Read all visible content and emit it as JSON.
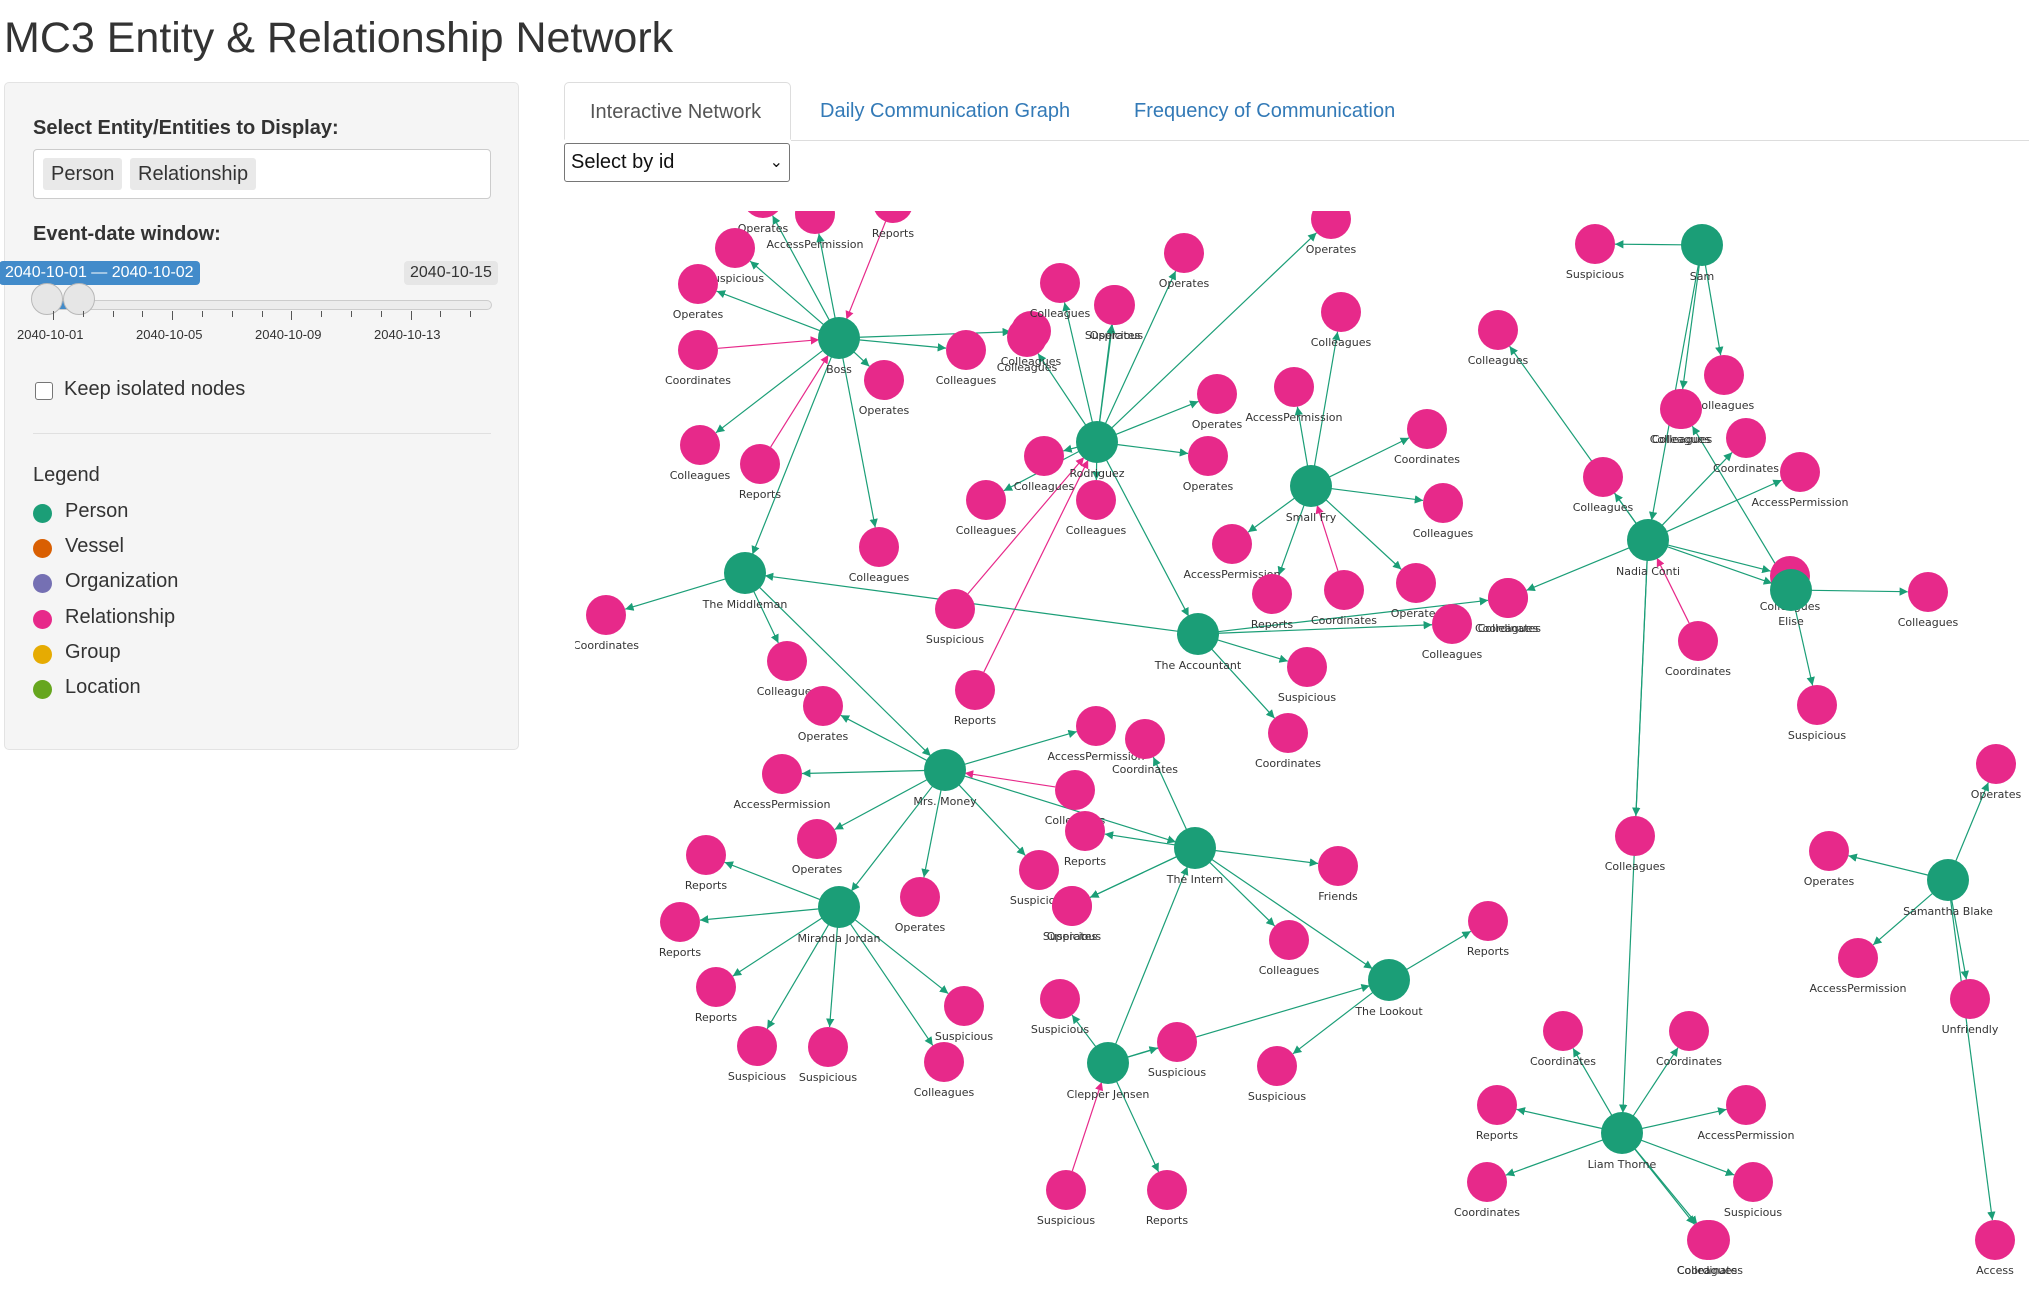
{
  "page": {
    "title": "MC3 Entity & Relationship Network"
  },
  "sidebar": {
    "entity_label": "Select Entity/Entities to Display:",
    "entity_chips": [
      "Person",
      "Relationship"
    ],
    "date_label": "Event-date window:",
    "slider": {
      "from_to_label": "2040-10-01 — 2040-10-02",
      "max_label": "2040-10-15",
      "grid_labels": [
        "2040-10-01",
        "2040-10-05",
        "2040-10-09",
        "2040-10-13"
      ],
      "selected_start": "2040-10-01",
      "selected_end": "2040-10-02"
    },
    "keep_isolated_label": "Keep isolated nodes",
    "keep_isolated_checked": false,
    "legend_title": "Legend",
    "legend": [
      {
        "label": "Person",
        "color": "#1b9e77"
      },
      {
        "label": "Vessel",
        "color": "#d95f02"
      },
      {
        "label": "Organization",
        "color": "#7570b3"
      },
      {
        "label": "Relationship",
        "color": "#e7298a"
      },
      {
        "label": "Group",
        "color": "#e6ab02"
      },
      {
        "label": "Location",
        "color": "#66a61e"
      }
    ]
  },
  "tabs": [
    {
      "label": "Interactive Network",
      "active": true
    },
    {
      "label": "Daily Communication Graph",
      "active": false
    },
    {
      "label": "Frequency of Communication",
      "active": false
    }
  ],
  "select_by_id": {
    "value": "Select by id"
  },
  "network": {
    "colors": {
      "person": "#1b9e77",
      "relationship": "#e7298a",
      "edge": "#1b9e77",
      "edge_alt": "#e7298a"
    },
    "persons": [
      {
        "id": "boss",
        "label": "Boss"
      },
      {
        "id": "rodriguez",
        "label": "Rodriguez"
      },
      {
        "id": "smallfry",
        "label": "Small Fry"
      },
      {
        "id": "sam",
        "label": "Sam"
      },
      {
        "id": "nadia",
        "label": "Nadia Conti"
      },
      {
        "id": "elise",
        "label": "Elise"
      },
      {
        "id": "middleman",
        "label": "The Middleman"
      },
      {
        "id": "accountant",
        "label": "The Accountant"
      },
      {
        "id": "money",
        "label": "Mrs. Money"
      },
      {
        "id": "intern",
        "label": "The Intern"
      },
      {
        "id": "miranda",
        "label": "Miranda Jordan"
      },
      {
        "id": "lookout",
        "label": "The Lookout"
      },
      {
        "id": "clepper",
        "label": "Clepper Jensen"
      },
      {
        "id": "liam",
        "label": "Liam Thorne"
      },
      {
        "id": "samantha",
        "label": "Samantha Blake"
      }
    ],
    "relationships": [
      {
        "label": "Operates",
        "from": "boss"
      },
      {
        "label": "AccessPermission",
        "from": "boss"
      },
      {
        "label": "Reports",
        "to": "boss"
      },
      {
        "label": "Suspicious",
        "from": "boss"
      },
      {
        "label": "Operates",
        "from": "boss"
      },
      {
        "label": "Coordinates",
        "to": "boss"
      },
      {
        "label": "Colleagues",
        "from": "boss"
      },
      {
        "label": "Operates",
        "from": "boss"
      },
      {
        "label": "Colleagues",
        "from": "boss"
      },
      {
        "label": "Reports",
        "to": "boss"
      },
      {
        "label": "Colleagues",
        "from": "boss"
      },
      {
        "label": "Colleagues",
        "from": "boss"
      },
      {
        "label": "Operates",
        "from": "rodriguez"
      },
      {
        "label": "Colleagues",
        "from": "rodriguez"
      },
      {
        "label": "Operates",
        "from": "rodriguez"
      },
      {
        "label": "Suspicious",
        "from": "rodriguez"
      },
      {
        "label": "Colleagues",
        "from": "rodriguez"
      },
      {
        "label": "Operates",
        "from": "rodriguez"
      },
      {
        "label": "Operates",
        "from": "rodriguez"
      },
      {
        "label": "Colleagues",
        "from": "rodriguez"
      },
      {
        "label": "Colleagues",
        "from": "rodriguez"
      },
      {
        "label": "Colleagues",
        "from": "rodriguez"
      },
      {
        "label": "Operates",
        "from": "rodriguez"
      },
      {
        "label": "AccessPermission",
        "from": "smallfry"
      },
      {
        "label": "Colleagues",
        "from": "smallfry"
      },
      {
        "label": "Coordinates",
        "from": "smallfry"
      },
      {
        "label": "Colleagues",
        "from": "smallfry"
      },
      {
        "label": "AccessPermission",
        "from": "smallfry"
      },
      {
        "label": "Reports",
        "from": "smallfry"
      },
      {
        "label": "Coordinates",
        "to": "smallfry"
      },
      {
        "label": "Operates",
        "from": "smallfry"
      },
      {
        "label": "Suspicious",
        "from": "sam"
      },
      {
        "label": "Colleagues",
        "from": "sam"
      },
      {
        "label": "Colleagues",
        "from": "sam"
      },
      {
        "label": "Colleagues",
        "from": "nadia"
      },
      {
        "label": "Coordinates",
        "from": "nadia"
      },
      {
        "label": "AccessPermission",
        "from": "nadia"
      },
      {
        "label": "Colleagues",
        "from": "nadia"
      },
      {
        "label": "Coordinates",
        "from": "nadia"
      },
      {
        "label": "Coordinates",
        "to": "nadia"
      },
      {
        "label": "Colleagues",
        "from": "nadia"
      },
      {
        "label": "Colleagues",
        "from": "elise"
      },
      {
        "label": "Suspicious",
        "from": "elise"
      },
      {
        "label": "Colleagues",
        "from": "elise"
      },
      {
        "label": "Coordinates",
        "from": "middleman"
      },
      {
        "label": "Colleagues",
        "from": "middleman"
      },
      {
        "label": "Suspicious",
        "from": "accountant"
      },
      {
        "label": "Coordinates",
        "from": "accountant"
      },
      {
        "label": "Colleagues",
        "from": "accountant"
      },
      {
        "label": "Colleagues",
        "from": "accountant"
      },
      {
        "label": "Suspicious",
        "to": "rodriguez"
      },
      {
        "label": "Reports",
        "to": "rodriguez"
      },
      {
        "label": "Operates",
        "from": "money"
      },
      {
        "label": "AccessPermission",
        "from": "money"
      },
      {
        "label": "Operates",
        "from": "money"
      },
      {
        "label": "Operates",
        "from": "money"
      },
      {
        "label": "AccessPermission",
        "from": "money"
      },
      {
        "label": "Colleagues",
        "to": "money"
      },
      {
        "label": "Suspicious",
        "from": "money"
      },
      {
        "label": "Coordinates",
        "from": "intern"
      },
      {
        "label": "Reports",
        "from": "intern"
      },
      {
        "label": "Operates",
        "from": "intern"
      },
      {
        "label": "Friends",
        "from": "intern"
      },
      {
        "label": "Colleagues",
        "from": "intern"
      },
      {
        "label": "Suspicious",
        "from": "intern"
      },
      {
        "label": "Reports",
        "from": "miranda"
      },
      {
        "label": "Reports",
        "from": "miranda"
      },
      {
        "label": "Reports",
        "from": "miranda"
      },
      {
        "label": "Suspicious",
        "from": "miranda"
      },
      {
        "label": "Suspicious",
        "from": "miranda"
      },
      {
        "label": "Colleagues",
        "from": "miranda"
      },
      {
        "label": "Suspicious",
        "from": "miranda"
      },
      {
        "label": "Reports",
        "from": "lookout"
      },
      {
        "label": "Suspicious",
        "from": "lookout"
      },
      {
        "label": "Suspicious",
        "from": "clepper"
      },
      {
        "label": "Suspicious",
        "from": "clepper"
      },
      {
        "label": "Reports",
        "from": "clepper"
      },
      {
        "label": "Suspicious",
        "to": "clepper"
      },
      {
        "label": "Colleagues",
        "from": "nadia"
      },
      {
        "label": "Coordinates",
        "from": "liam"
      },
      {
        "label": "Coordinates",
        "from": "liam"
      },
      {
        "label": "Reports",
        "from": "liam"
      },
      {
        "label": "AccessPermission",
        "from": "liam"
      },
      {
        "label": "Coordinates",
        "from": "liam"
      },
      {
        "label": "Suspicious",
        "from": "liam"
      },
      {
        "label": "Coordinates",
        "from": "liam"
      },
      {
        "label": "Colleagues",
        "from": "liam"
      },
      {
        "label": "Operates",
        "from": "samantha"
      },
      {
        "label": "Operates",
        "from": "samantha"
      },
      {
        "label": "AccessPermission",
        "from": "samantha"
      },
      {
        "label": "Unfriendly",
        "from": "samantha"
      },
      {
        "label": "Access",
        "from": "samantha"
      }
    ]
  }
}
